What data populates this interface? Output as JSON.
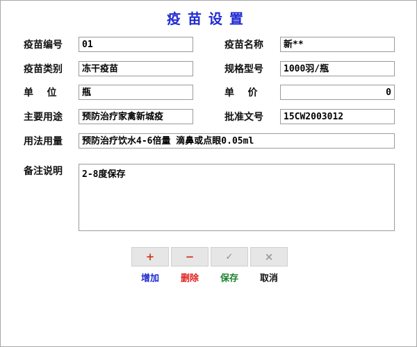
{
  "title": "疫苗设置",
  "colors": {
    "title": "#1f2ad1",
    "add": "#d13a1c",
    "delete": "#d1321c",
    "save_icon": "#8a8a8a",
    "cancel_icon": "#9a9a9a",
    "add_label": "#1f2ad1",
    "delete_label": "#e11d1d",
    "save_label": "#1a7f2b",
    "cancel_label": "#111111"
  },
  "form": {
    "code": {
      "label": "疫苗编号",
      "value": "01"
    },
    "name": {
      "label": "疫苗名称",
      "value": "新**"
    },
    "category": {
      "label": "疫苗类别",
      "value": "冻干疫苗"
    },
    "spec": {
      "label": "规格型号",
      "value": "1000羽/瓶"
    },
    "unit": {
      "label": "单    位",
      "value": "瓶"
    },
    "price": {
      "label": "单    价",
      "value": "0"
    },
    "purpose": {
      "label": "主要用途",
      "value": "预防治疗家禽新城疫"
    },
    "approval": {
      "label": "批准文号",
      "value": "15CW2003012"
    },
    "usage": {
      "label": "用法用量",
      "value": "预防治疗饮水4-6倍量 滴鼻或点眼0.05ml"
    },
    "remark": {
      "label": "备注说明",
      "value": "2-8度保存"
    }
  },
  "toolbar": {
    "add": {
      "icon": "plus-icon",
      "glyph": "+",
      "label": "增加"
    },
    "delete": {
      "icon": "minus-icon",
      "glyph": "−",
      "label": "删除"
    },
    "save": {
      "icon": "check-icon",
      "glyph": "✓",
      "label": "保存"
    },
    "cancel": {
      "icon": "x-icon",
      "glyph": "×",
      "label": "取消"
    }
  }
}
